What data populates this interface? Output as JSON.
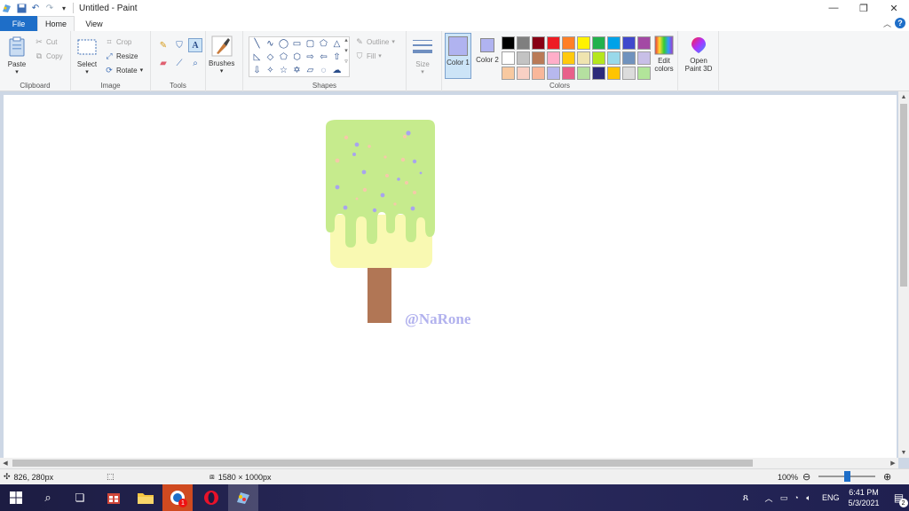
{
  "window": {
    "title": "Untitled - Paint",
    "controls": {
      "minimize": "—",
      "maximize": "❐",
      "close": "✕"
    }
  },
  "tabs": [
    {
      "label": "File"
    },
    {
      "label": "Home"
    },
    {
      "label": "View"
    }
  ],
  "ribbon": {
    "clipboard": {
      "paste": "Paste",
      "cut": "Cut",
      "copy": "Copy",
      "label": "Clipboard"
    },
    "image": {
      "select": "Select",
      "crop": "Crop",
      "resize": "Resize",
      "rotate": "Rotate",
      "label": "Image"
    },
    "tools": {
      "label": "Tools"
    },
    "brushes": {
      "label": "Brushes"
    },
    "shapes": {
      "outline": "Outline",
      "fill": "Fill",
      "label": "Shapes"
    },
    "size": {
      "label": "Size"
    },
    "colors": {
      "color1": "Color 1",
      "color2": "Color 2",
      "color1_hex": "#b0b3f0",
      "color2_hex": "#b0b3f0",
      "edit": "Edit colors",
      "label": "Colors",
      "palette": [
        "#000000",
        "#7f7f7f",
        "#880015",
        "#ed1c24",
        "#ff7f27",
        "#fff200",
        "#22b14c",
        "#00a2e8",
        "#3f48cc",
        "#a349a4",
        "#ffffff",
        "#c3c3c3",
        "#b97a57",
        "#ffaec9",
        "#ffc90e",
        "#efe4b0",
        "#b5e61d",
        "#99d9ea",
        "#7092be",
        "#c8bfe7",
        "#f8c9a0",
        "#f8d0c4",
        "#f9b79a",
        "#b7b8ee",
        "#e8608a",
        "#b5e0a0",
        "#2c2a7a",
        "#ffc400",
        "#dcdcdc",
        "#b2e59a"
      ]
    },
    "paint3d": "Open Paint 3D"
  },
  "canvas": {
    "watermark": "@NaRone",
    "colors": {
      "topping": "#c6eb8d",
      "base": "#f9f9b2",
      "stick": "#b17655",
      "watermark": "#b2b2ee"
    }
  },
  "status": {
    "cursor": "826, 280px",
    "size": "1580 × 1000px",
    "zoom": "100%",
    "zoom_fraction": 0.5
  },
  "taskbar": {
    "badge": "1",
    "lang": "ENG",
    "time": "6:41 PM",
    "date": "5/3/2021",
    "notifications": "2"
  }
}
